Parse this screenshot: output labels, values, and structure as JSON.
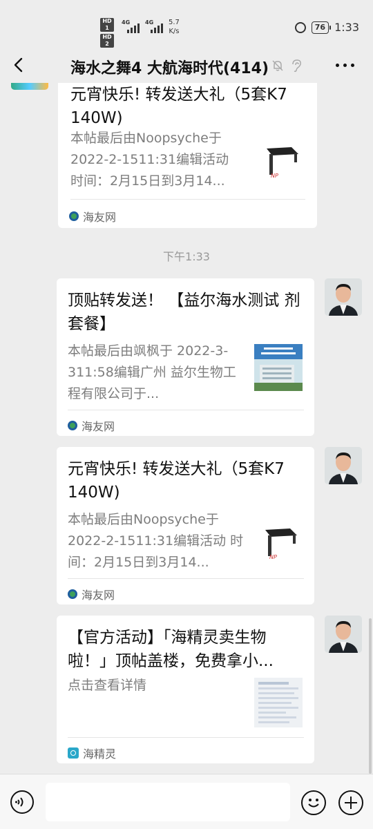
{
  "status_bar": {
    "hd1": "HD 1",
    "hd2": "HD 2",
    "net1": "4G",
    "net2": "4G",
    "speed_value": "5.7",
    "speed_unit": "K/s",
    "battery": "76",
    "time": "1:33",
    "icons": [
      "alarm-icon",
      "battery-icon"
    ]
  },
  "header": {
    "title": "海水之舞4 大航海时代(414)",
    "icons": [
      "back-icon",
      "mute-icon",
      "ear-icon",
      "more-icon"
    ]
  },
  "messages": [
    {
      "title": "元宵快乐! 转发送大礼（5套K7 140W)",
      "desc": "本帖最后由Noopsyche于 2022-2-1511:31编辑活动 时间：2月15日到3月14...",
      "source": "海友网",
      "thumb": "lamp-image"
    },
    {
      "timestamp": "下午1:33"
    },
    {
      "title": "顶贴转发送！ 【益尔海水测试 剂套餐】",
      "desc": "本帖最后由飒枫于 2022-3-311:58编辑广州 益尔生物工程有限公司于...",
      "source": "海友网",
      "thumb": "building-image"
    },
    {
      "title": "元宵快乐! 转发送大礼（5套K7 140W)",
      "desc": "本帖最后由Noopsyche于 2022-2-1511:31编辑活动 时间：2月15日到3月14...",
      "source": "海友网",
      "thumb": "lamp-image"
    },
    {
      "title": "【官方活动】「海精灵卖生物 啦！」顶帖盖楼，免费拿小...",
      "desc": "点击查看详情",
      "source": "海精灵",
      "thumb": "document-image"
    }
  ],
  "input_bar": {
    "icons": [
      "voice-icon",
      "emoji-icon",
      "plus-icon"
    ],
    "placeholder": ""
  }
}
